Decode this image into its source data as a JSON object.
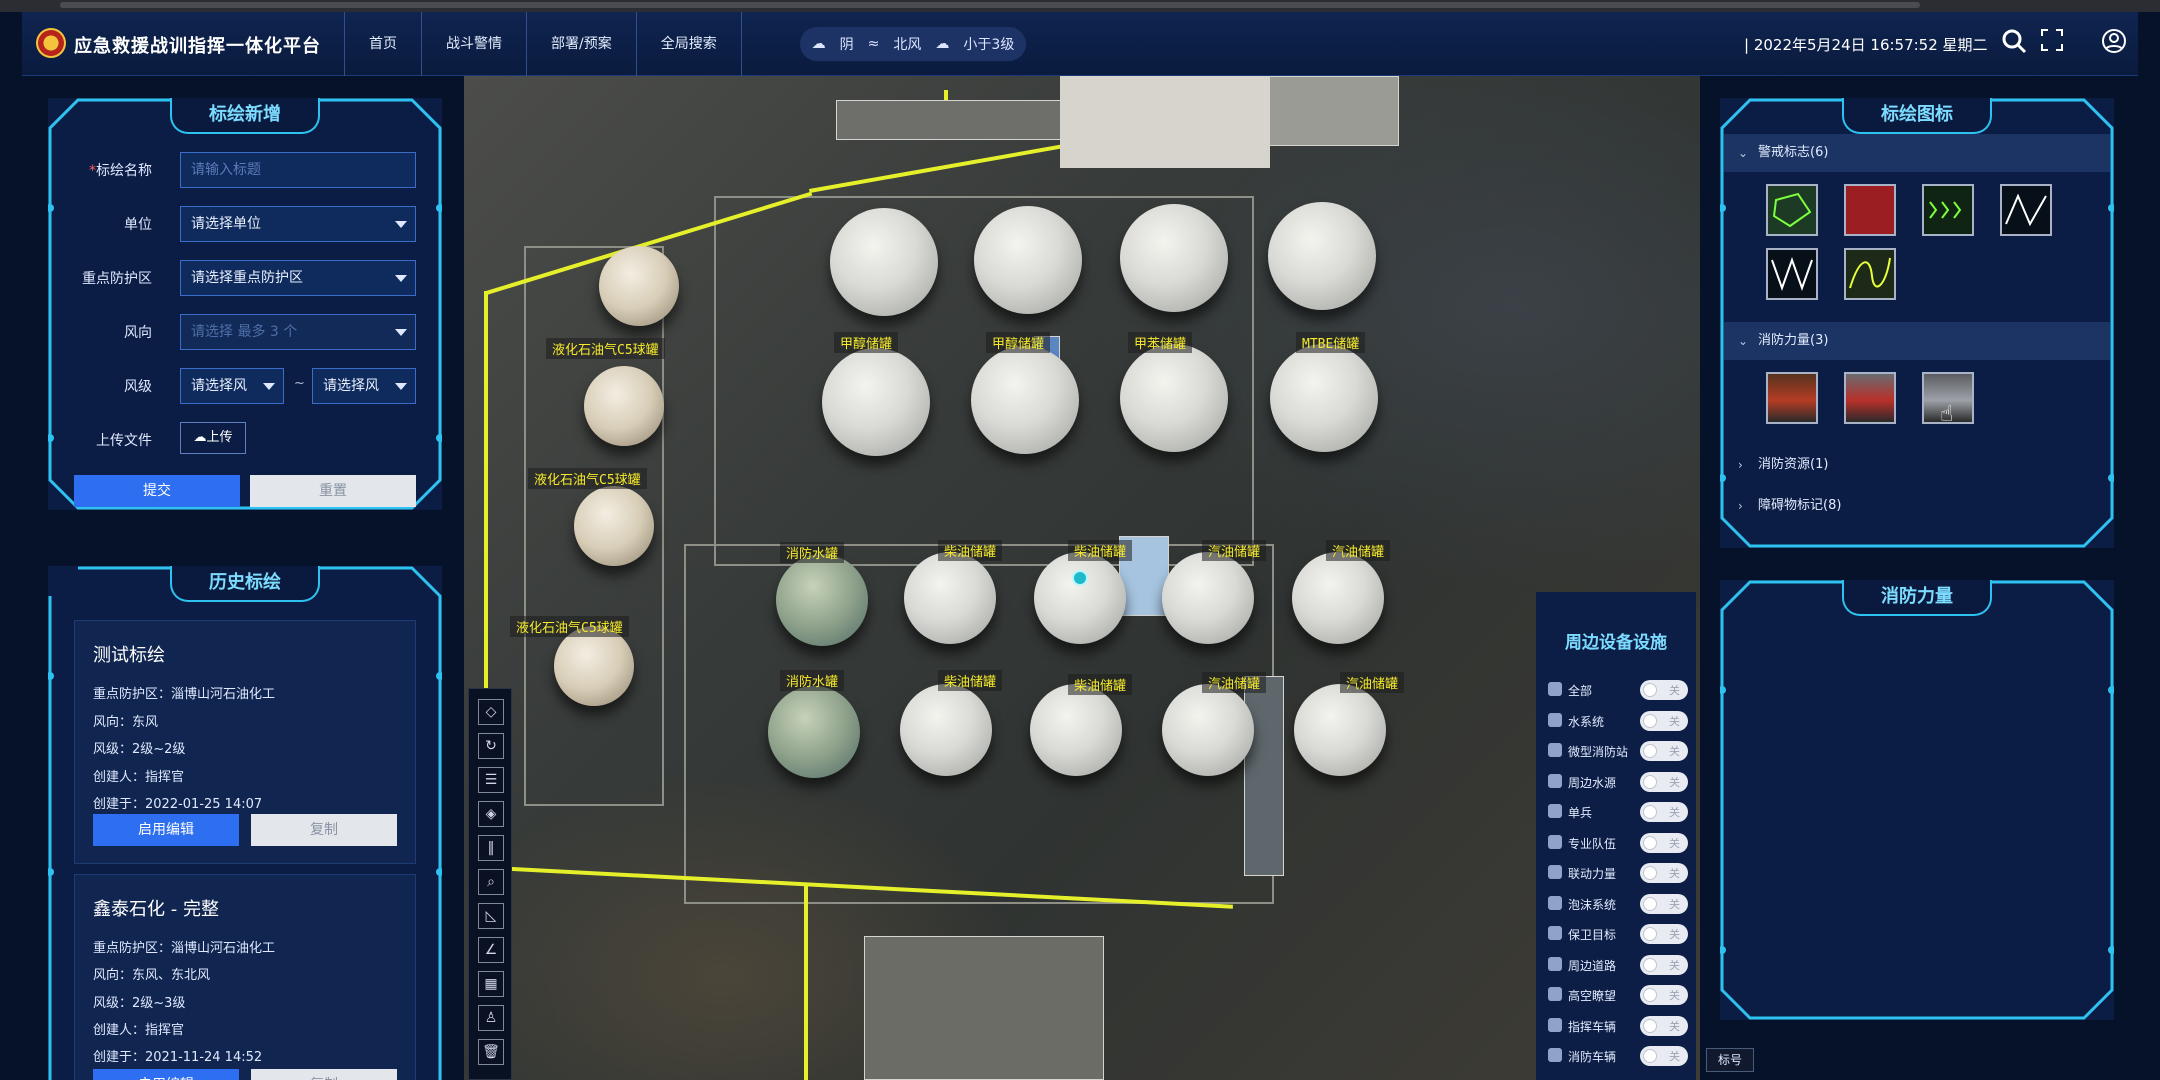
{
  "header": {
    "app_title": "应急救援战训指挥一体化平台",
    "nav": [
      "首页",
      "战斗警情",
      "部署/预案",
      "全局搜索"
    ],
    "weather": {
      "sky": "阴",
      "wind": "北风",
      "level": "小于3级"
    },
    "datetime": "| 2022年5月24日 16:57:52 星期二",
    "icons": [
      "search-icon",
      "fullscreen-icon",
      "user-icon"
    ]
  },
  "new_marking": {
    "title": "标绘新增",
    "name_label_req": "*",
    "name_label": "标绘名称",
    "name_placeholder": "请输入标题",
    "unit_label": "单位",
    "unit_value": "请选择单位",
    "zone_label": "重点防护区",
    "zone_value": "请选择重点防护区",
    "wind_dir_label": "风向",
    "wind_dir_placeholder": "请选择 最多 3 个",
    "wind_level_label": "风级",
    "wind_from": "请选择风",
    "tilde": "~",
    "wind_to": "请选择风",
    "upload_label": "上传文件",
    "upload_btn": "上传",
    "submit": "提交",
    "reset": "重置"
  },
  "history": {
    "title": "历史标绘",
    "cards": [
      {
        "title": "测试标绘",
        "zone": "重点防护区：淄博山河石油化工",
        "wind": "风向：东风",
        "level": "风级：2级~2级",
        "creator": "创建人：指挥官",
        "created": "创建于：2022-01-25 14:07",
        "edit": "启用编辑",
        "copy": "复制"
      },
      {
        "title": "鑫泰石化 - 完整",
        "zone": "重点防护区：淄博山河石油化工",
        "wind": "风向：东风、东北风",
        "level": "风级：2级~3级",
        "creator": "创建人：指挥官",
        "created": "创建于：2021-11-24 14:52",
        "edit": "启用编辑",
        "copy": "复制"
      }
    ]
  },
  "map_labels": [
    "液化石油气C5球罐",
    "液化石油气C5球罐",
    "液化石油气C5球罐",
    "甲醇储罐",
    "甲醇储罐",
    "甲苯储罐",
    "MTBE储罐",
    "消防水罐",
    "柴油储罐",
    "柴油储罐",
    "汽油储罐",
    "汽油储罐",
    "消防水罐",
    "柴油储罐",
    "柴油储罐",
    "汽油储罐",
    "汽油储罐"
  ],
  "devices": {
    "title": "周边设备设施",
    "off": "关",
    "items": [
      "全部",
      "水系统",
      "微型消防站",
      "周边水源",
      "单兵",
      "专业队伍",
      "联动力量",
      "泡沫系统",
      "保卫目标",
      "周边道路",
      "高空瞭望",
      "指挥车辆",
      "消防车辆"
    ]
  },
  "icons_panel": {
    "title": "标绘图标",
    "sections": [
      {
        "label": "警戒标志(6)",
        "open": true
      },
      {
        "label": "消防力量(3)",
        "open": true
      },
      {
        "label": "消防资源(1)",
        "open": false
      },
      {
        "label": "障碍物标记(8)",
        "open": false
      }
    ]
  },
  "force_panel": {
    "title": "消防力量"
  },
  "tag_button": "标号",
  "colors": {
    "accent": "#2dc2f0",
    "primary": "#2e6ef0",
    "label": "#f6ea2b"
  }
}
